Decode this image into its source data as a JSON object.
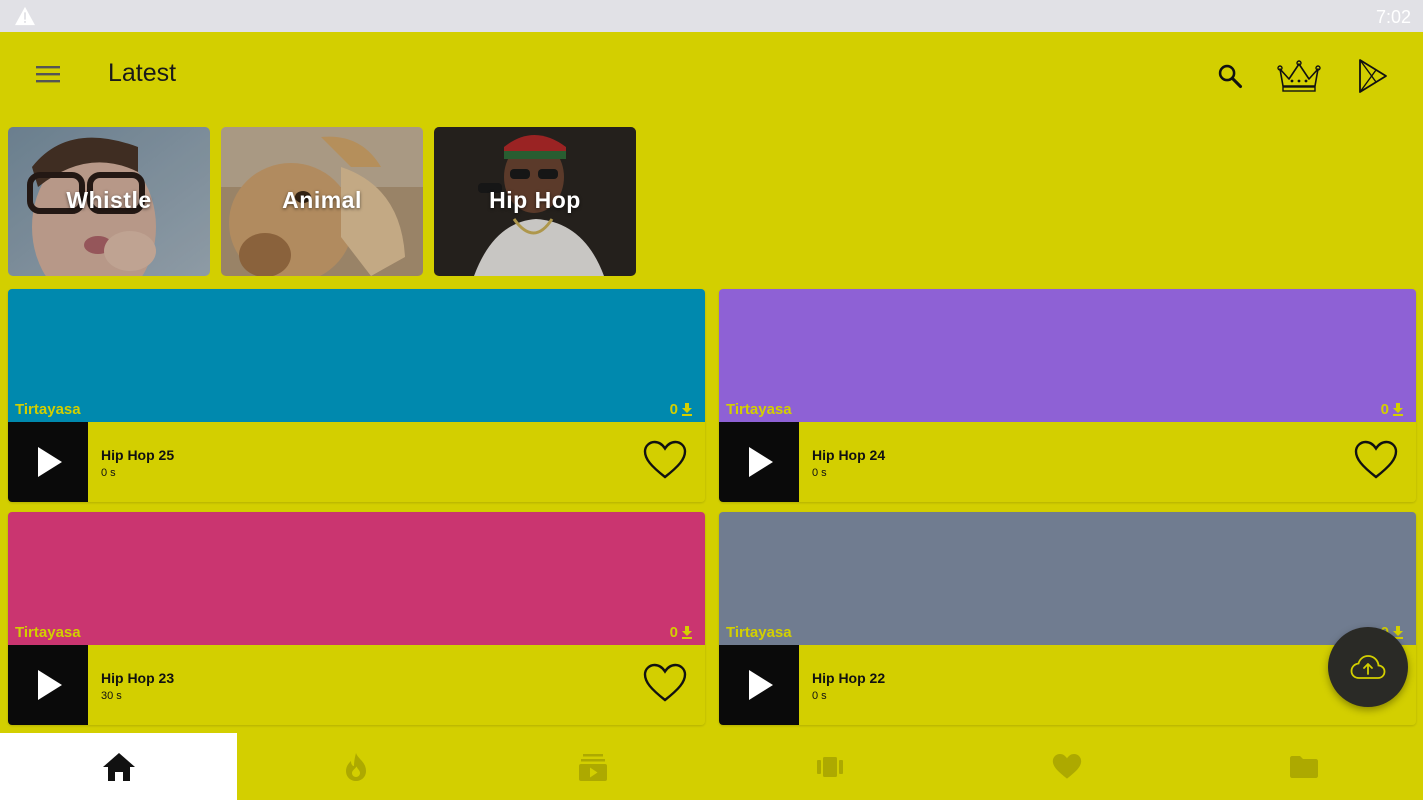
{
  "status_bar": {
    "time": "7:02",
    "warning_icon": "warning-triangle-icon"
  },
  "app_bar": {
    "title": "Latest",
    "menu_icon": "hamburger-menu-icon",
    "search_icon": "search-icon",
    "crown_icon": "crown-icon",
    "play_store_icon": "play-store-icon"
  },
  "categories": [
    {
      "label": "Whistle"
    },
    {
      "label": "Animal"
    },
    {
      "label": "Hip Hop"
    }
  ],
  "colors": {
    "accent": "#d3cf00",
    "card_teal": "#0089ae",
    "card_purple": "#8e61d5",
    "card_pink": "#ca3570",
    "card_slate": "#707c90"
  },
  "ringtones": [
    {
      "title": "Hip Hop 25",
      "duration": "0 s",
      "author": "Tirtayasa",
      "downloads": "0",
      "color": "#0089ae"
    },
    {
      "title": "Hip Hop 24",
      "duration": "0 s",
      "author": "Tirtayasa",
      "downloads": "0",
      "color": "#8e61d5"
    },
    {
      "title": "Hip Hop 23",
      "duration": "30 s",
      "author": "Tirtayasa",
      "downloads": "0",
      "color": "#ca3570"
    },
    {
      "title": "Hip Hop 22",
      "duration": "0 s",
      "author": "Tirtayasa",
      "downloads": "0",
      "color": "#707c90"
    }
  ],
  "fab": {
    "icon": "cloud-upload-icon"
  },
  "bottom_nav": [
    {
      "icon": "home-icon",
      "active": true
    },
    {
      "icon": "fire-icon",
      "active": false
    },
    {
      "icon": "video-library-icon",
      "active": false
    },
    {
      "icon": "carousel-icon",
      "active": false
    },
    {
      "icon": "heart-icon",
      "active": false
    },
    {
      "icon": "folder-icon",
      "active": false
    }
  ]
}
